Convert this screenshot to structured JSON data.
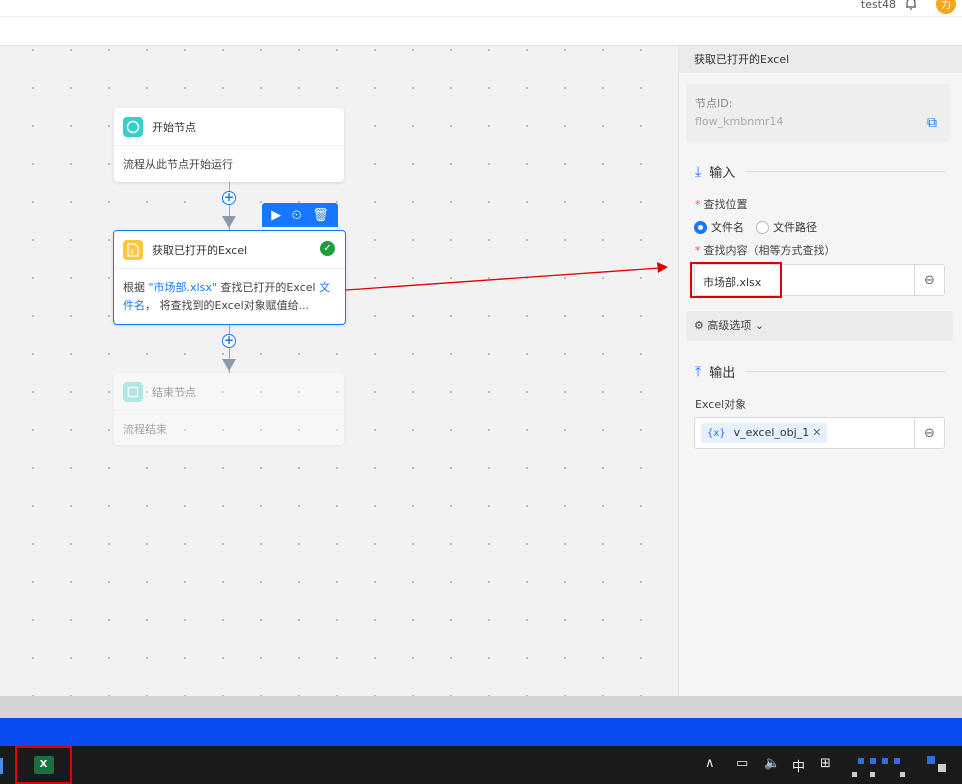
{
  "topbar": {
    "username": "test48",
    "avatar_text": "力"
  },
  "canvas": {
    "start_node": {
      "title": "开始节点",
      "desc": "流程从此节点开始运行"
    },
    "excel_node": {
      "title": "获取已打开的Excel",
      "desc_prefix": "根据 ",
      "desc_file": "\"市场部.xlsx\"",
      "desc_mid": " 查找已打开的Excel ",
      "desc_mode": "文件名",
      "desc_suffix": "， 将查找到的Excel对象赋值给..."
    },
    "end_node": {
      "title": "结束节点",
      "desc": "流程结束"
    }
  },
  "panel": {
    "header": "获取已打开的Excel",
    "node_id_label": "节点ID:",
    "node_id_value": "flow_kmbnmr14",
    "input_section": "输入",
    "search_position_label": "查找位置",
    "radio_filename": "文件名",
    "radio_filepath": "文件路径",
    "search_content_label": "查找内容（相等方式查找）",
    "search_content_value": "市场部.xlsx",
    "advanced_label": "高级选项",
    "output_section": "输出",
    "excel_obj_label": "Excel对象",
    "excel_obj_var_icon": "{x}",
    "excel_obj_value": "v_excel_obj_1"
  },
  "taskbar": {
    "ime": "中"
  }
}
